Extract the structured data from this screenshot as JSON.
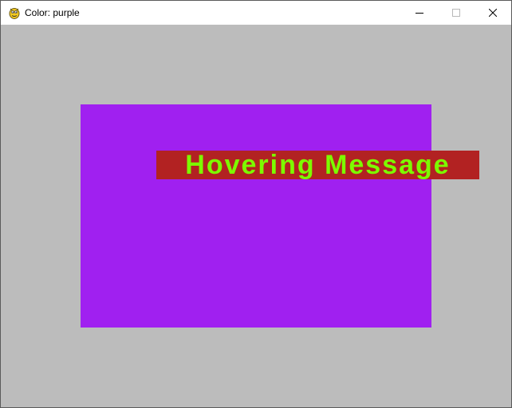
{
  "window": {
    "title": "Color: purple",
    "app_icon": "pygame-snake-icon"
  },
  "controls": {
    "minimize_icon": "minimize-icon",
    "maximize_icon": "maximize-icon",
    "close_icon": "close-icon"
  },
  "canvas": {
    "background_color": "#bcbcbc",
    "rect_color": "#a020f0",
    "banner_color": "#b22222",
    "message_color": "#7cfc00",
    "message": "Hovering Message"
  }
}
